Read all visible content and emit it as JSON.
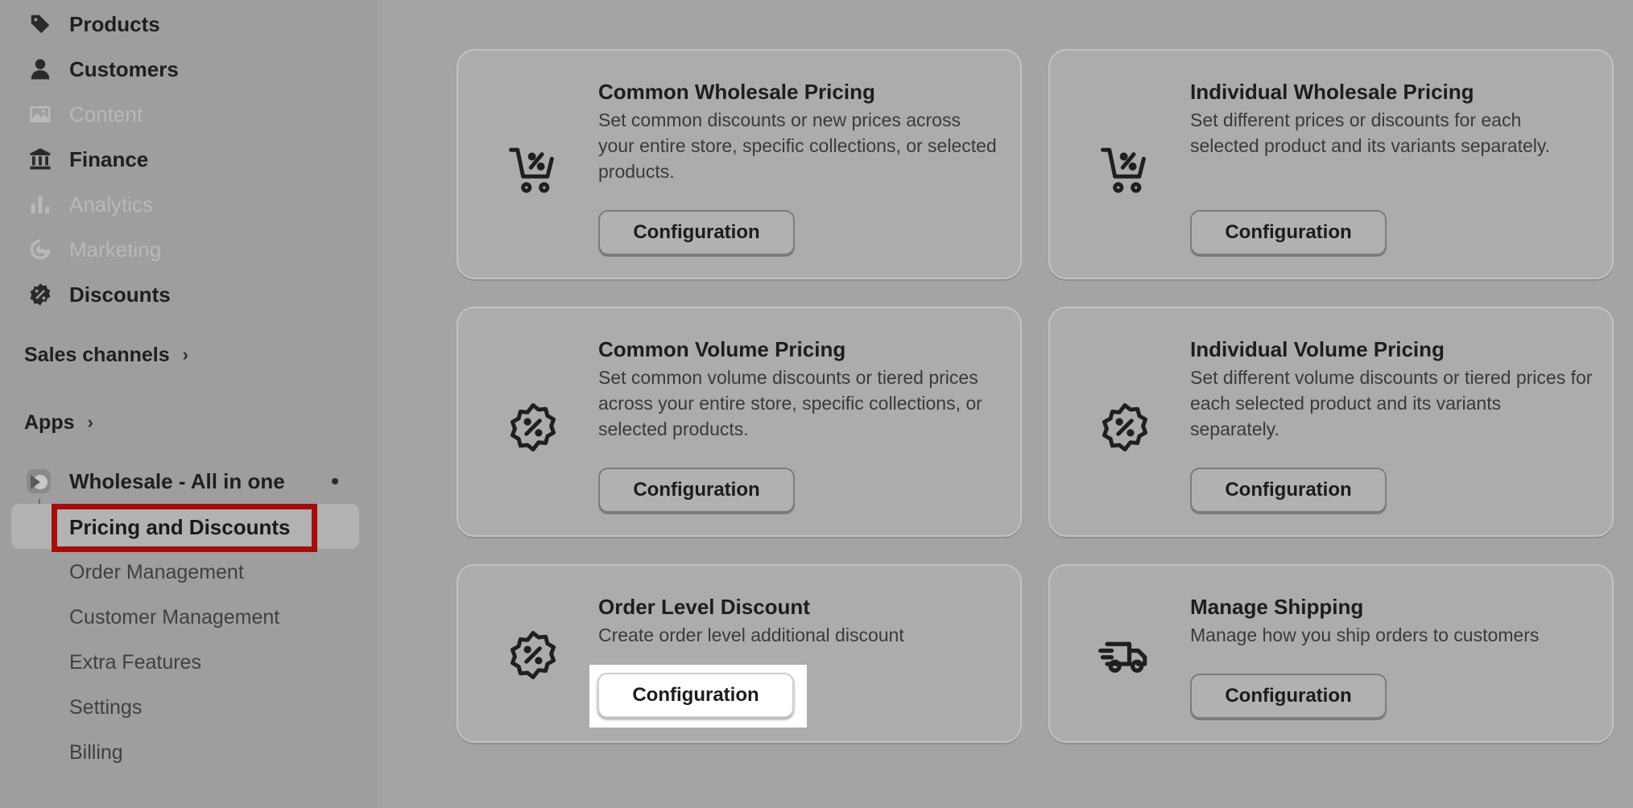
{
  "sidebar": {
    "nav": [
      {
        "label": "Products",
        "icon": "tag-icon",
        "disabled": false
      },
      {
        "label": "Customers",
        "icon": "person-icon",
        "disabled": false
      },
      {
        "label": "Content",
        "icon": "image-icon",
        "disabled": true
      },
      {
        "label": "Finance",
        "icon": "bank-icon",
        "disabled": false
      },
      {
        "label": "Analytics",
        "icon": "bar-chart-icon",
        "disabled": true
      },
      {
        "label": "Marketing",
        "icon": "target-icon",
        "disabled": true
      },
      {
        "label": "Discounts",
        "icon": "discount-badge-icon",
        "disabled": false
      }
    ],
    "sales_channels": "Sales channels",
    "apps": "Apps",
    "chevron": "›",
    "app_name": "Wholesale - All in one",
    "sub_items": [
      {
        "label": "Pricing and Discounts",
        "active": true
      },
      {
        "label": "Order Management",
        "active": false
      },
      {
        "label": "Customer Management",
        "active": false
      },
      {
        "label": "Extra Features",
        "active": false
      },
      {
        "label": "Settings",
        "active": false
      },
      {
        "label": "Billing",
        "active": false
      }
    ]
  },
  "cards": [
    {
      "title": "Common Wholesale Pricing",
      "description": "Set common discounts or new prices across your entire store, specific collections, or selected products.",
      "button": "Configuration",
      "icon": "cart-percent-icon"
    },
    {
      "title": "Individual Wholesale Pricing",
      "description": "Set different prices or discounts for each selected product and its variants separately.",
      "button": "Configuration",
      "icon": "cart-percent-icon"
    },
    {
      "title": "Common Volume Pricing",
      "description": "Set common volume discounts or tiered prices across your entire store, specific collections, or selected products.",
      "button": "Configuration",
      "icon": "discount-badge-icon"
    },
    {
      "title": "Individual Volume Pricing",
      "description": "Set different volume discounts or tiered prices for each selected product and its variants separately.",
      "button": "Configuration",
      "icon": "discount-badge-icon"
    },
    {
      "title": "Order Level Discount",
      "description": "Create order level additional discount",
      "button": "Configuration",
      "icon": "discount-badge-icon"
    },
    {
      "title": "Manage Shipping",
      "description": "Manage how you ship orders to customers",
      "button": "Configuration",
      "icon": "delivery-truck-icon"
    }
  ],
  "colors": {
    "highlight_border": "#a40d0d",
    "focus_background": "#ffffff"
  }
}
